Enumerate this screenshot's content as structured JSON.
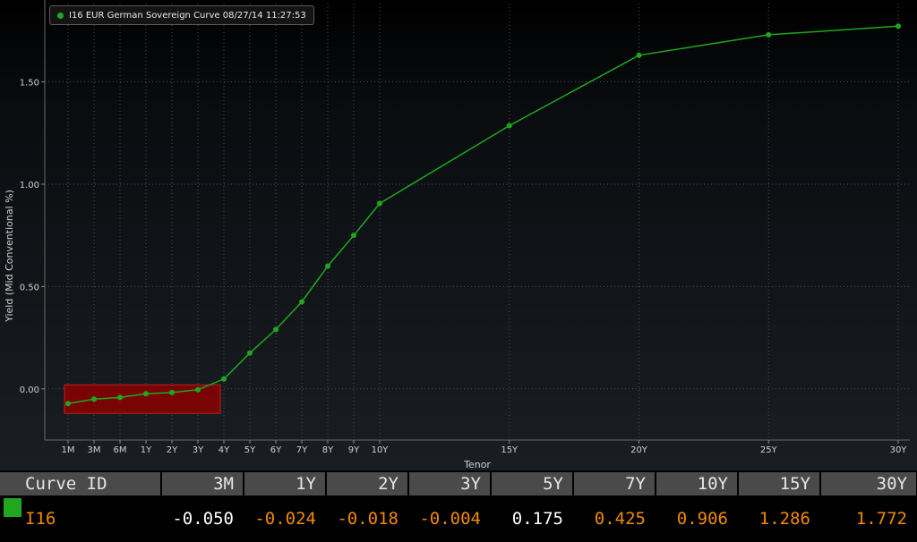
{
  "legend": {
    "label": "I16 EUR German Sovereign Curve 08/27/14 11:27:53",
    "color": "#1fa81f"
  },
  "chart_data": {
    "type": "line",
    "xlabel": "Tenor",
    "ylabel": "Yield (Mid Conventional %)",
    "ylim": [
      -0.25,
      1.9
    ],
    "yticks": [
      0.0,
      0.5,
      1.0,
      1.5
    ],
    "ytick_labels": [
      "0.00",
      "0.50",
      "1.00",
      "1.50"
    ],
    "grid": true,
    "x_scale": "tenor-years (non-uniform)",
    "series": [
      {
        "name": "I16 EUR German Sovereign Curve 08/27/14 11:27:53",
        "color": "#1fa81f",
        "points": [
          {
            "tenor": "1M",
            "years": 0.0833,
            "y": -0.072
          },
          {
            "tenor": "3M",
            "years": 0.25,
            "y": -0.05
          },
          {
            "tenor": "6M",
            "years": 0.5,
            "y": -0.042
          },
          {
            "tenor": "1Y",
            "years": 1,
            "y": -0.024
          },
          {
            "tenor": "2Y",
            "years": 2,
            "y": -0.018
          },
          {
            "tenor": "3Y",
            "years": 3,
            "y": -0.004
          },
          {
            "tenor": "4Y",
            "years": 4,
            "y": 0.048
          },
          {
            "tenor": "5Y",
            "years": 5,
            "y": 0.175
          },
          {
            "tenor": "6Y",
            "years": 6,
            "y": 0.29
          },
          {
            "tenor": "7Y",
            "years": 7,
            "y": 0.425
          },
          {
            "tenor": "8Y",
            "years": 8,
            "y": 0.6
          },
          {
            "tenor": "9Y",
            "years": 9,
            "y": 0.75
          },
          {
            "tenor": "10Y",
            "years": 10,
            "y": 0.906
          },
          {
            "tenor": "15Y",
            "years": 15,
            "y": 1.286
          },
          {
            "tenor": "20Y",
            "years": 20,
            "y": 1.63
          },
          {
            "tenor": "25Y",
            "years": 25,
            "y": 1.73
          },
          {
            "tenor": "30Y",
            "years": 30,
            "y": 1.772
          }
        ]
      }
    ],
    "highlight": {
      "from_tenor": "1M",
      "to_tenor": "3Y",
      "y_range": [
        -0.12,
        0.02
      ],
      "color": "#8b0000"
    }
  },
  "table": {
    "headers": [
      "Curve ID",
      "3M",
      "1Y",
      "2Y",
      "3Y",
      "5Y",
      "7Y",
      "10Y",
      "15Y",
      "30Y"
    ],
    "rows": [
      {
        "id": "I16",
        "swatch_color": "#1fa81f",
        "values": [
          "-0.050",
          "-0.024",
          "-0.018",
          "-0.004",
          "0.175",
          "0.425",
          "0.906",
          "1.286",
          "1.772"
        ]
      }
    ]
  }
}
